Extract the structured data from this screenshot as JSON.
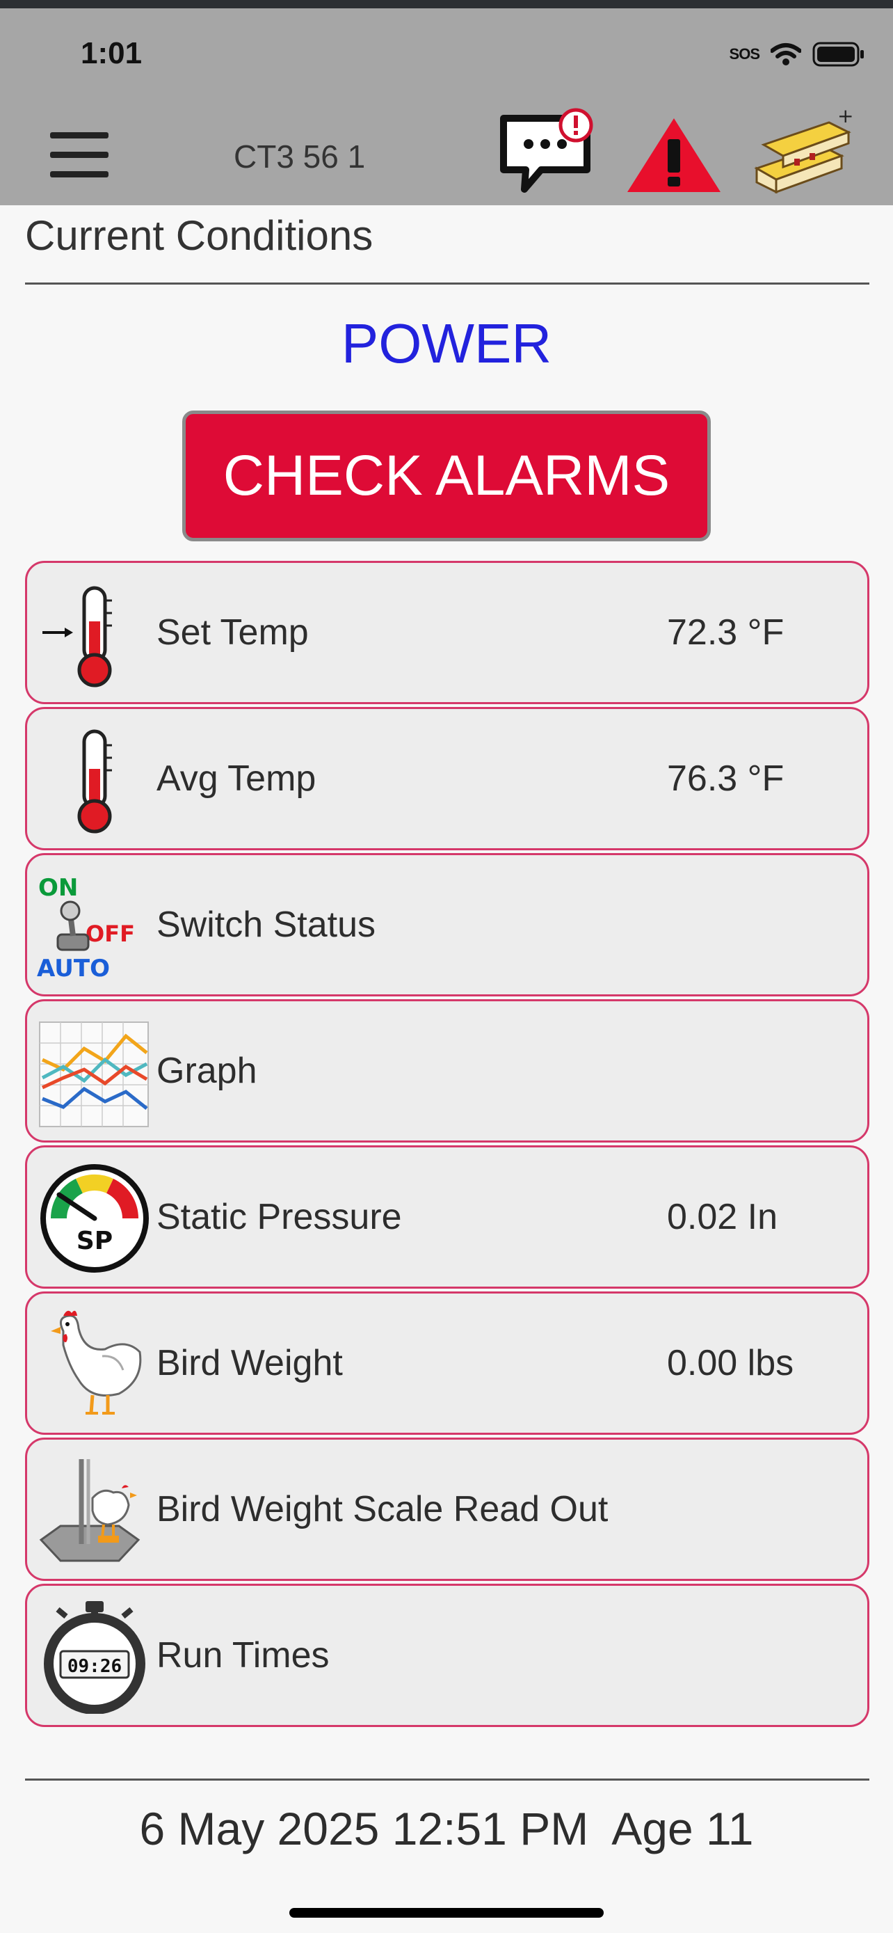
{
  "status_bar": {
    "time": "1:01",
    "sos": "SOS"
  },
  "header": {
    "device_name": "CT3 56 1"
  },
  "icons": {
    "menu": "hamburger-menu-icon",
    "messages": "message-alert-icon",
    "alarm": "warning-triangle-icon",
    "houses": "add-house-icon"
  },
  "page": {
    "title": "Current Conditions",
    "power_label": "POWER",
    "alarm_button": "CHECK ALARMS"
  },
  "items": [
    {
      "label": "Set Temp",
      "value": "72.3 °F",
      "icon": "thermometer-set-icon"
    },
    {
      "label": "Avg Temp",
      "value": "76.3 °F",
      "icon": "thermometer-icon"
    },
    {
      "label": "Switch Status",
      "value": "",
      "icon": "switch-icon",
      "on": "ON",
      "off": "OFF",
      "auto": "AUTO"
    },
    {
      "label": "Graph",
      "value": "",
      "icon": "graph-icon"
    },
    {
      "label": "Static Pressure",
      "value": "0.02 In",
      "icon": "pressure-gauge-icon",
      "badge": "SP"
    },
    {
      "label": "Bird Weight",
      "value": "0.00 lbs",
      "icon": "chicken-icon"
    },
    {
      "label": "Bird Weight Scale Read Out",
      "value": "",
      "icon": "scale-chicken-icon"
    },
    {
      "label": "Run Times",
      "value": "",
      "icon": "stopwatch-icon",
      "clock": "09:26"
    }
  ],
  "footer": {
    "datetime": "6 May 2025 12:51 PM  Age 11"
  },
  "colors": {
    "accent_red": "#de0b36",
    "power_blue": "#2222dd",
    "row_border": "#d5386a",
    "header_gray": "#a6a6a6"
  }
}
